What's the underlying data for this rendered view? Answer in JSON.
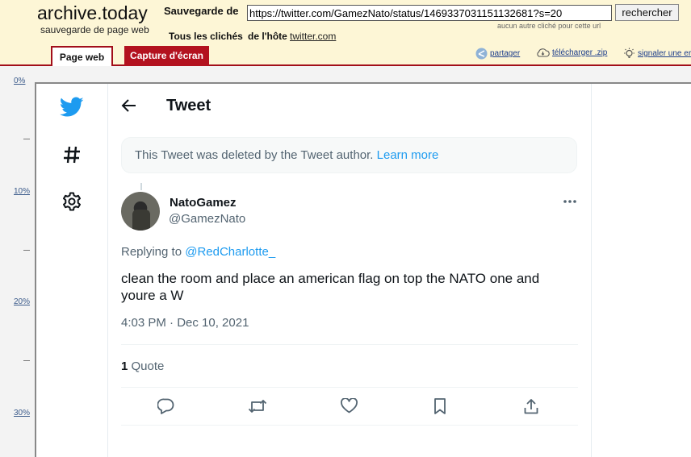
{
  "archive": {
    "logo": "archive.today",
    "logo_sub": "sauvegarde de page web",
    "save_label": "Sauvegarde de",
    "url_value": "https://twitter.com/GamezNato/status/1469337031151132681?s=20",
    "search_button": "rechercher",
    "no_other_snapshot": "aucun autre cliché pour cette url",
    "all_snapshots": "Tous les clichés",
    "from_host": "de l'hôte",
    "host": "twitter.com",
    "tabs": [
      "Page web",
      "Capture d'écran"
    ],
    "actions": {
      "share": "partager",
      "download": "télécharger .zip",
      "report": "signaler une erreur"
    },
    "ruler": [
      "0%",
      "10%",
      "20%",
      "30%"
    ]
  },
  "tweet": {
    "header_title": "Tweet",
    "deleted_notice": "This Tweet was deleted by the Tweet author.",
    "learn_more": "Learn more",
    "author_name": "NatoGamez",
    "author_handle": "@GamezNato",
    "replying_to_prefix": "Replying to",
    "replying_to_handle": "@RedCharlotte_",
    "text": "clean the room and place an american flag on top the NATO one and youre a W",
    "timestamp": "4:03 PM · Dec 10, 2021",
    "quote_count": "1",
    "quote_label": "Quote"
  },
  "colors": {
    "archive_red": "#a20e1a",
    "twitter_blue": "#1d9bf0",
    "header_bg": "#fdf6d6"
  }
}
